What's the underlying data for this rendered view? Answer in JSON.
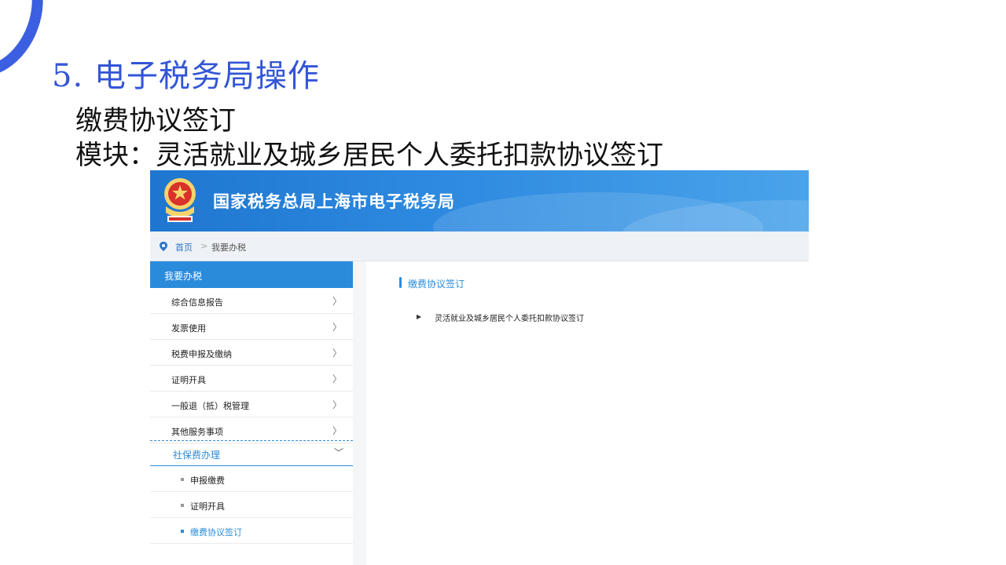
{
  "slide": {
    "title": "5. 电子税务局操作",
    "subtitle": "缴费协议签订",
    "module_line": "模块：灵活就业及城乡居民个人委托扣款协议签订",
    "accent_color": "#3355d6"
  },
  "portal": {
    "banner_title": "国家税务总局上海市电子税务局",
    "breadcrumb": {
      "home": "首页",
      "separator": ">",
      "current": "我要办税"
    },
    "sidebar": {
      "header": "我要办税",
      "items": [
        {
          "label": "综合信息报告",
          "chevron": "〉"
        },
        {
          "label": "发票使用",
          "chevron": "〉"
        },
        {
          "label": "税费申报及缴纳",
          "chevron": "〉"
        },
        {
          "label": "证明开具",
          "chevron": "〉"
        },
        {
          "label": "一般退（抵）税管理",
          "chevron": "〉"
        },
        {
          "label": "其他服务事项",
          "chevron": "〉"
        }
      ],
      "expanded": {
        "label": "社保费办理",
        "chevron": "﹀"
      },
      "sub_items": [
        {
          "label": "申报缴费"
        },
        {
          "label": "证明开具"
        },
        {
          "label": "缴费协议签订",
          "active": true
        }
      ]
    },
    "content": {
      "section_title": "缴费协议签订",
      "links": [
        {
          "label": "灵活就业及城乡居民个人委托扣款协议签订",
          "arrow": "▶"
        }
      ]
    },
    "primary_color": "#2a8bdb"
  }
}
